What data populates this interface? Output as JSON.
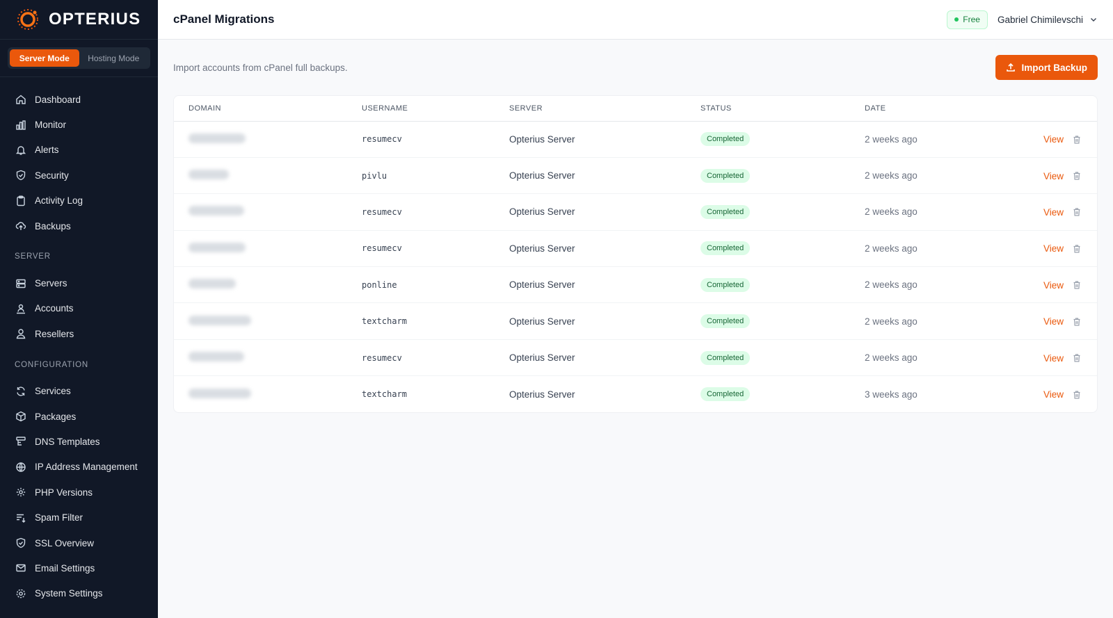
{
  "app": {
    "name": "OPTERIUS"
  },
  "modes": {
    "server": "Server Mode",
    "hosting": "Hosting Mode"
  },
  "nav": {
    "main": [
      {
        "label": "Dashboard",
        "icon": "home-icon"
      },
      {
        "label": "Monitor",
        "icon": "bar-chart-icon"
      },
      {
        "label": "Alerts",
        "icon": "bell-icon"
      },
      {
        "label": "Security",
        "icon": "shield-icon"
      },
      {
        "label": "Activity Log",
        "icon": "clipboard-icon"
      },
      {
        "label": "Backups",
        "icon": "cloud-upload-icon"
      }
    ],
    "server_section": "SERVER",
    "server": [
      {
        "label": "Servers",
        "icon": "server-icon"
      },
      {
        "label": "Accounts",
        "icon": "accounts-icon"
      },
      {
        "label": "Resellers",
        "icon": "users-icon"
      }
    ],
    "config_section": "CONFIGURATION",
    "config": [
      {
        "label": "Services",
        "icon": "refresh-icon"
      },
      {
        "label": "Packages",
        "icon": "package-icon"
      },
      {
        "label": "DNS Templates",
        "icon": "dns-icon"
      },
      {
        "label": "IP Address Management",
        "icon": "globe-icon"
      },
      {
        "label": "PHP Versions",
        "icon": "gear-icon"
      },
      {
        "label": "Spam Filter",
        "icon": "filter-icon"
      },
      {
        "label": "SSL Overview",
        "icon": "shield-check-icon"
      },
      {
        "label": "Email Settings",
        "icon": "mail-icon"
      },
      {
        "label": "System Settings",
        "icon": "settings-icon"
      }
    ]
  },
  "header": {
    "title": "cPanel Migrations",
    "plan": "Free",
    "user": "Gabriel Chimilevschi"
  },
  "main": {
    "subtitle": "Import accounts from cPanel full backups.",
    "import_button": "Import Backup"
  },
  "table": {
    "columns": [
      "DOMAIN",
      "USERNAME",
      "SERVER",
      "STATUS",
      "DATE"
    ],
    "view_label": "View",
    "rows": [
      {
        "username": "resumecv",
        "server": "Opterius Server",
        "status": "Completed",
        "date": "2 weeks ago"
      },
      {
        "username": "pivlu",
        "server": "Opterius Server",
        "status": "Completed",
        "date": "2 weeks ago"
      },
      {
        "username": "resumecv",
        "server": "Opterius Server",
        "status": "Completed",
        "date": "2 weeks ago"
      },
      {
        "username": "resumecv",
        "server": "Opterius Server",
        "status": "Completed",
        "date": "2 weeks ago"
      },
      {
        "username": "ponline",
        "server": "Opterius Server",
        "status": "Completed",
        "date": "2 weeks ago"
      },
      {
        "username": "textcharm",
        "server": "Opterius Server",
        "status": "Completed",
        "date": "2 weeks ago"
      },
      {
        "username": "resumecv",
        "server": "Opterius Server",
        "status": "Completed",
        "date": "2 weeks ago"
      },
      {
        "username": "textcharm",
        "server": "Opterius Server",
        "status": "Completed",
        "date": "3 weeks ago"
      }
    ]
  },
  "colors": {
    "accent": "#ea580c",
    "sidebar": "#111827",
    "success_bg": "#dcfce7",
    "success_text": "#166534"
  }
}
